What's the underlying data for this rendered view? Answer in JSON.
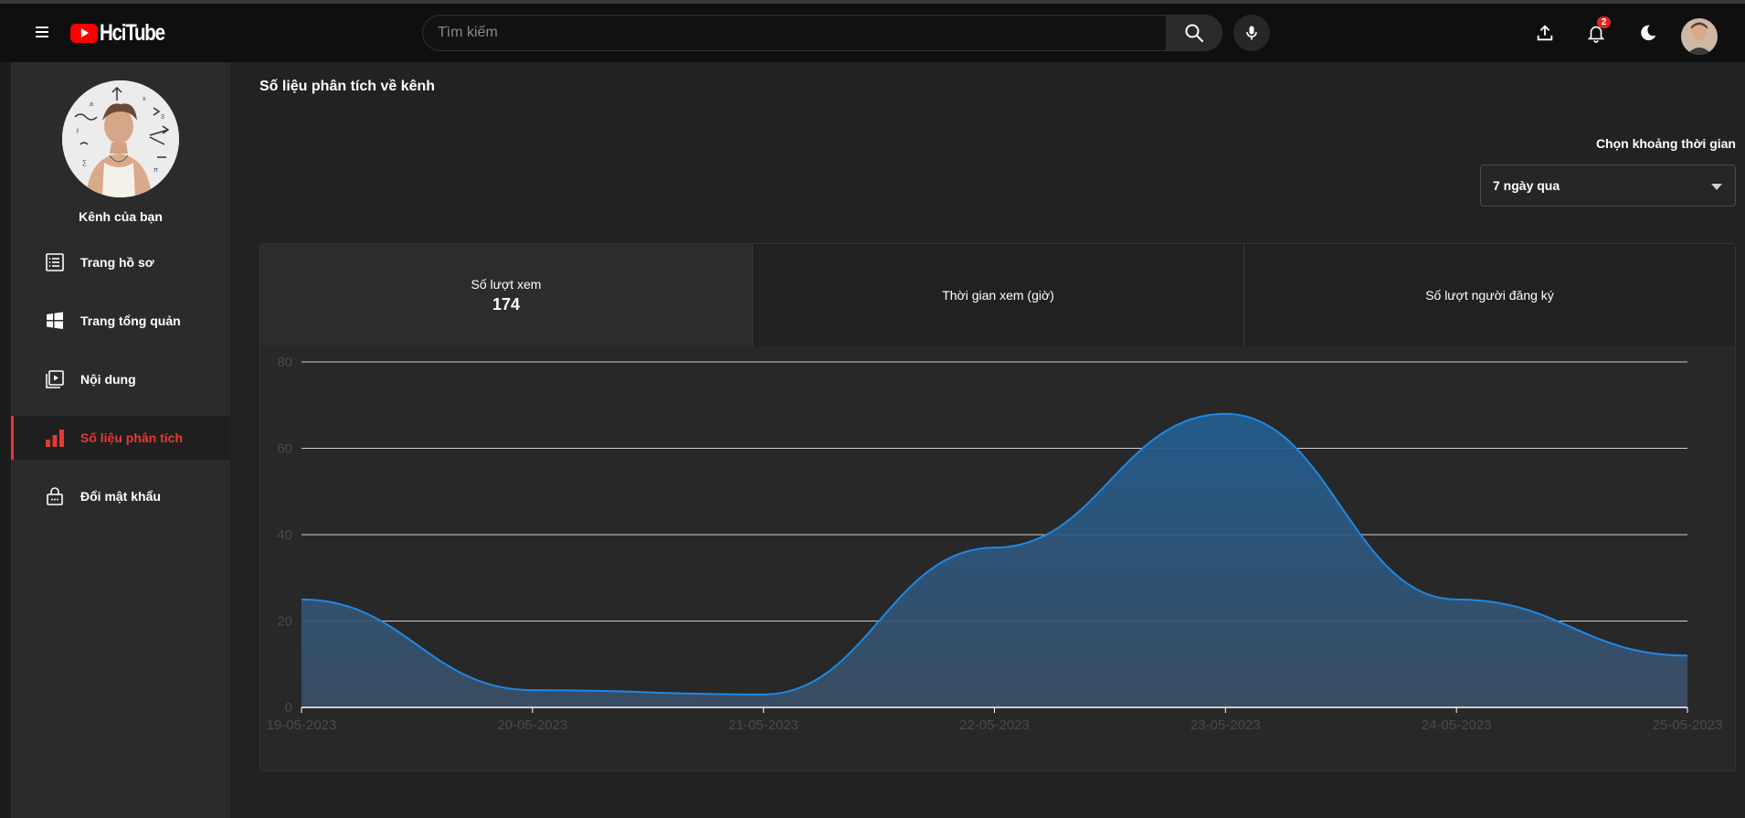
{
  "app": {
    "logo_text": "HciTube"
  },
  "header": {
    "search_placeholder": "Tìm kiếm",
    "notification_count": "2",
    "icons": [
      "menu-icon",
      "search-icon",
      "mic-icon",
      "upload-icon",
      "bell-icon",
      "moon-icon"
    ]
  },
  "sidebar": {
    "channel_label": "Kênh của bạn",
    "items": [
      {
        "label": "Trang hồ sơ",
        "icon": "profile-list-icon"
      },
      {
        "label": "Trang tổng quản",
        "icon": "dashboard-grid-icon"
      },
      {
        "label": "Nội dung",
        "icon": "video-library-icon"
      },
      {
        "label": "Số liệu phân tích",
        "icon": "bar-chart-icon",
        "active": true
      },
      {
        "label": "Đổi mật khẩu",
        "icon": "lock-icon"
      }
    ]
  },
  "main": {
    "title": "Số liệu phân tích về kênh",
    "range_label": "Chọn khoảng thời gian",
    "range_value": "7 ngày qua",
    "tabs": [
      {
        "label": "Số lượt xem",
        "value": "174",
        "active": true
      },
      {
        "label": "Thời gian xem (giờ)",
        "value": ""
      },
      {
        "label": "Số lượt người đăng ký",
        "value": ""
      }
    ]
  },
  "colors": {
    "accent": "#e53935",
    "line": "#1e88e5",
    "fill": "#2f5f8a"
  },
  "chart_data": {
    "type": "area",
    "x": [
      "19-05-2023",
      "20-05-2023",
      "21-05-2023",
      "22-05-2023",
      "23-05-2023",
      "24-05-2023",
      "25-05-2023"
    ],
    "series": [
      {
        "values": [
          25,
          4,
          3,
          37,
          68,
          25,
          12
        ]
      }
    ],
    "ylim": [
      0,
      80
    ],
    "yticks": [
      0,
      20,
      40,
      60,
      80
    ],
    "grid": true,
    "legend": "none"
  }
}
